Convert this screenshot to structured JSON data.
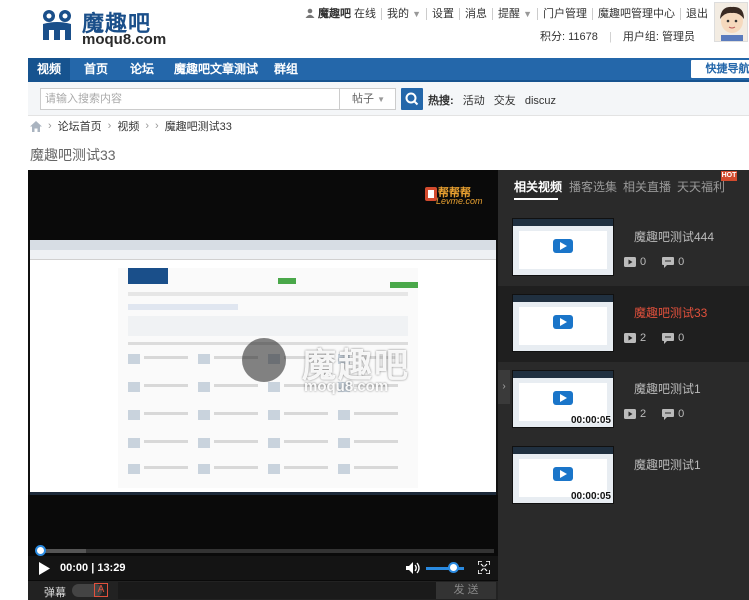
{
  "header": {
    "logo_cn": "魔趣吧",
    "logo_en": "moqu8.com",
    "topnav": {
      "username": "魔趣吧",
      "online": "在线",
      "mine": "我的",
      "settings": "设置",
      "messages": "消息",
      "reminders": "提醒",
      "portal_admin": "门户管理",
      "admin_center": "魔趣吧管理中心",
      "logout": "退出"
    },
    "credits": "积分: 11678",
    "user_group": "用户组: 管理员"
  },
  "navbar": {
    "tabs": [
      {
        "label": "视频",
        "active": true
      },
      {
        "label": "首页",
        "active": false
      },
      {
        "label": "论坛",
        "active": false
      },
      {
        "label": "魔趣吧文章测试",
        "active": false
      },
      {
        "label": "群组",
        "active": false
      }
    ],
    "quick_nav": "快捷导航"
  },
  "search": {
    "placeholder": "请输入搜索内容",
    "type": "帖子",
    "hot_label": "热搜:",
    "hot_terms": [
      "活动",
      "交友",
      "discuz"
    ]
  },
  "breadcrumb": {
    "items": [
      "论坛首页",
      "视频",
      "魔趣吧测试33"
    ]
  },
  "page_title": "魔趣吧测试33",
  "player": {
    "brand_cn": "帮帮帮",
    "brand_en": "Levme.com",
    "watermark_cn": "魔趣吧",
    "watermark_en": "moqu8.com",
    "time": "00:00 | 13:29",
    "progress": 0,
    "volume": 0.7,
    "danmu_label": "弹幕",
    "danmu_a": "A",
    "send_label": "发 送"
  },
  "sidebar": {
    "tabs": [
      {
        "label": "相关视频",
        "active": true
      },
      {
        "label": "播客选集",
        "active": false
      },
      {
        "label": "相关直播",
        "active": false
      },
      {
        "label": "天天福利",
        "active": false
      }
    ],
    "hot_badge": "HOT",
    "items": [
      {
        "title": "魔趣吧测试444",
        "plays": "0",
        "comments": "0",
        "duration": "",
        "active": false
      },
      {
        "title": "魔趣吧测试33",
        "plays": "2",
        "comments": "0",
        "duration": "",
        "active": true
      },
      {
        "title": "魔趣吧测试1",
        "plays": "2",
        "comments": "0",
        "duration": "00:00:05",
        "active": false
      },
      {
        "title": "魔趣吧测试1",
        "plays": "0",
        "comments": "0",
        "duration": "00:00:05",
        "active": false
      }
    ]
  }
}
